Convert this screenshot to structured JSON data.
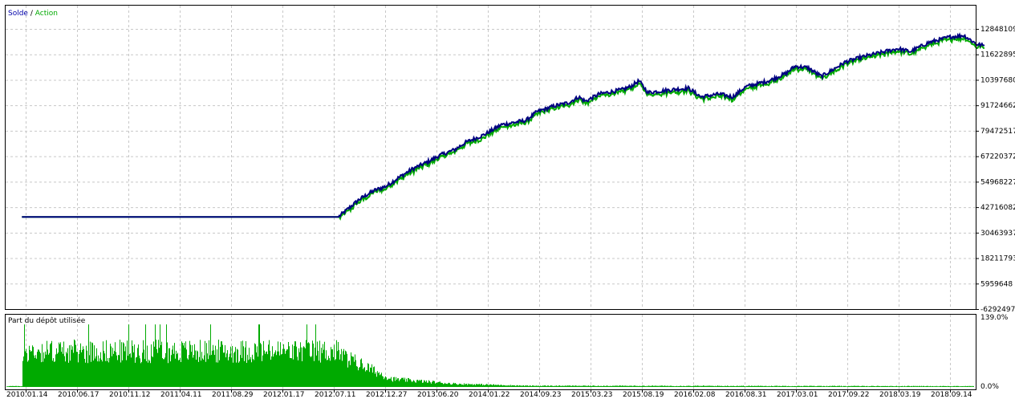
{
  "chart_data": [
    {
      "type": "line",
      "legend": {
        "items": [
          {
            "label": "Solde",
            "color": "#0000aa"
          },
          {
            "separator": " / "
          },
          {
            "label": "Action",
            "color": "#00aa00"
          }
        ],
        "placement": "top-left"
      },
      "y_ticks": [
        "12848109",
        "11622895",
        "10397680",
        "9172466​2",
        "79472517",
        "67220372",
        "54968227",
        "42716082",
        "30463937",
        "18211793",
        "5959648",
        "-6292497"
      ],
      "ylim": [
        -6292497,
        12848109
      ],
      "grid": true,
      "series": [
        {
          "name": "Solde",
          "color": "#000080",
          "points": [
            [
              "2010.01.01",
              0
            ],
            [
              "2011.06.01",
              0
            ],
            [
              "2012.06.01",
              0
            ],
            [
              "2012.12.20",
              0
            ],
            [
              "2013.03.01",
              1200000
            ],
            [
              "2013.04.20",
              1800000
            ],
            [
              "2013.06.01",
              2100000
            ],
            [
              "2013.07.15",
              2700000
            ],
            [
              "2013.09.01",
              3300000
            ],
            [
              "2013.10.15",
              3700000
            ],
            [
              "2013.12.01",
              4200000
            ],
            [
              "2014.01.22",
              4600000
            ],
            [
              "2014.03.01",
              5100000
            ],
            [
              "2014.05.01",
              5600000
            ],
            [
              "2014.07.01",
              6300000
            ],
            [
              "2014.09.23",
              6600000
            ],
            [
              "2014.11.01",
              7200000
            ],
            [
              "2015.01.01",
              7600000
            ],
            [
              "2015.02.15",
              7800000
            ],
            [
              "2015.03.23",
              8200000
            ],
            [
              "2015.04.15",
              7900000
            ],
            [
              "2015.06.01",
              8400000
            ],
            [
              "2015.08.19",
              8700000
            ],
            [
              "2015.09.15",
              8900000
            ],
            [
              "2015.10.15",
              9300000
            ],
            [
              "2015.11.15",
              8500000
            ],
            [
              "2016.02.08",
              8700000
            ],
            [
              "2016.04.01",
              8800000
            ],
            [
              "2016.05.15",
              8200000
            ],
            [
              "2016.07.15",
              8400000
            ],
            [
              "2016.08.31",
              8200000
            ],
            [
              "2016.10.15",
              8900000
            ],
            [
              "2017.01.01",
              9300000
            ],
            [
              "2017.03.01",
              9800000
            ],
            [
              "2017.04.01",
              10300000
            ],
            [
              "2017.05.15",
              10200000
            ],
            [
              "2017.07.01",
              9600000
            ],
            [
              "2017.09.22",
              10600000
            ],
            [
              "2017.12.01",
              11000000
            ],
            [
              "2018.03.19",
              11500000
            ],
            [
              "2018.05.01",
              11300000
            ],
            [
              "2018.07.01",
              11900000
            ],
            [
              "2018.09.14",
              12300000
            ],
            [
              "2018.11.01",
              12400000
            ],
            [
              "2018.12.15",
              11800000
            ],
            [
              "2019.01.10",
              11700000
            ]
          ]
        },
        {
          "name": "Action",
          "color": "#00aa00",
          "offset": -160000
        }
      ]
    },
    {
      "type": "bar",
      "title": "Part du dépôt utilisée",
      "y_ticks": [
        "139.0%",
        "0.0%"
      ],
      "ylim": [
        0,
        139
      ],
      "color": "#00aa00",
      "regimes": [
        [
          "2010.01.01",
          90
        ],
        [
          "2012.12.27",
          80
        ],
        [
          "2013.06.20",
          20
        ],
        [
          "2014.01.22",
          8
        ],
        [
          "2014.09.23",
          3
        ],
        [
          "2019.01.10",
          2
        ]
      ]
    }
  ],
  "x_ticks": [
    "2010.01.14",
    "2010.06.17",
    "2010.11.12",
    "2011.04.11",
    "2011.08.29",
    "2012.01.17",
    "2012.07.11",
    "2012.12.27",
    "2013.06.20",
    "2014.01.22",
    "2014.09.23",
    "2015.03.23",
    "2015.08.19",
    "2016.02.08",
    "2016.08.31",
    "2017.03.01",
    "2017.09.22",
    "2018.03.19",
    "2018.09.14"
  ],
  "colors": {
    "grid": "#c8c8c8",
    "frame": "#000000",
    "background": "#ffffff"
  }
}
